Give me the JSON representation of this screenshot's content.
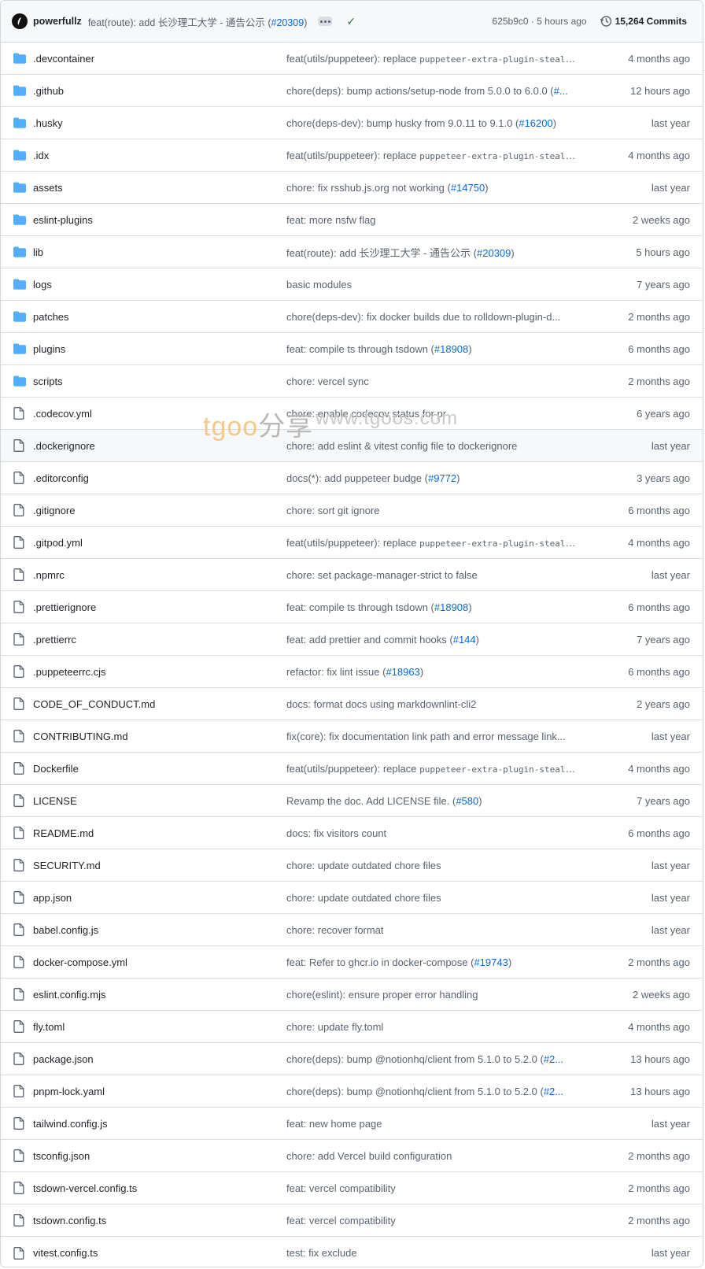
{
  "latest_commit": {
    "author": "powerfullz",
    "message": "feat(route): add 长沙理工大学 - 通告公示 (",
    "pr": "#20309",
    "message_end": ")",
    "sha_time": "625b9c0 · 5 hours ago",
    "commits_count": "15,264 Commits"
  },
  "watermark": {
    "brand": "tgoo",
    "cn": "分享",
    "url": "www.tgoos.com"
  },
  "rows": [
    {
      "type": "folder",
      "name": ".devcontainer",
      "pre": "feat(utils/puppeteer): replace ",
      "code": "puppeteer-extra-plugin-stealt...",
      "pr": "",
      "post": "",
      "age": "4 months ago"
    },
    {
      "type": "folder",
      "name": ".github",
      "pre": "chore(deps): bump actions/setup-node from 5.0.0 to 6.0.0 (",
      "code": "",
      "pr": "#...",
      "post": "",
      "age": "12 hours ago"
    },
    {
      "type": "folder",
      "name": ".husky",
      "pre": "chore(deps-dev): bump husky from 9.0.11 to 9.1.0 (",
      "code": "",
      "pr": "#16200",
      "post": ")",
      "age": "last year"
    },
    {
      "type": "folder",
      "name": ".idx",
      "pre": "feat(utils/puppeteer): replace ",
      "code": "puppeteer-extra-plugin-stealt...",
      "pr": "",
      "post": "",
      "age": "4 months ago"
    },
    {
      "type": "folder",
      "name": "assets",
      "pre": "chore: fix rsshub.js.org not working (",
      "code": "",
      "pr": "#14750",
      "post": ")",
      "age": "last year"
    },
    {
      "type": "folder",
      "name": "eslint-plugins",
      "pre": "feat: more nsfw flag",
      "code": "",
      "pr": "",
      "post": "",
      "age": "2 weeks ago"
    },
    {
      "type": "folder",
      "name": "lib",
      "pre": "feat(route): add 长沙理工大学 - 通告公示 (",
      "code": "",
      "pr": "#20309",
      "post": ")",
      "age": "5 hours ago"
    },
    {
      "type": "folder",
      "name": "logs",
      "pre": "basic modules",
      "code": "",
      "pr": "",
      "post": "",
      "age": "7 years ago"
    },
    {
      "type": "folder",
      "name": "patches",
      "pre": "chore(deps-dev): fix docker builds due to rolldown-plugin-d...",
      "code": "",
      "pr": "",
      "post": "",
      "age": "2 months ago"
    },
    {
      "type": "folder",
      "name": "plugins",
      "pre": "feat: compile ts through tsdown (",
      "code": "",
      "pr": "#18908",
      "post": ")",
      "age": "6 months ago"
    },
    {
      "type": "folder",
      "name": "scripts",
      "pre": "chore: vercel sync",
      "code": "",
      "pr": "",
      "post": "",
      "age": "2 months ago"
    },
    {
      "type": "file",
      "name": ".codecov.yml",
      "pre": "chore: enable codecov status for pr",
      "code": "",
      "pr": "",
      "post": "",
      "age": "6 years ago"
    },
    {
      "type": "file",
      "name": ".dockerignore",
      "pre": "chore: add eslint & vitest config file to dockerignore",
      "code": "",
      "pr": "",
      "post": "",
      "age": "last year",
      "highlight": true
    },
    {
      "type": "file",
      "name": ".editorconfig",
      "pre": "docs(*): add puppeteer budge (",
      "code": "",
      "pr": "#9772",
      "post": ")",
      "age": "3 years ago"
    },
    {
      "type": "file",
      "name": ".gitignore",
      "pre": "chore: sort git ignore",
      "code": "",
      "pr": "",
      "post": "",
      "age": "6 months ago"
    },
    {
      "type": "file",
      "name": ".gitpod.yml",
      "pre": "feat(utils/puppeteer): replace ",
      "code": "puppeteer-extra-plugin-stealt...",
      "pr": "",
      "post": "",
      "age": "4 months ago"
    },
    {
      "type": "file",
      "name": ".npmrc",
      "pre": "chore: set package-manager-strict to false",
      "code": "",
      "pr": "",
      "post": "",
      "age": "last year"
    },
    {
      "type": "file",
      "name": ".prettierignore",
      "pre": "feat: compile ts through tsdown (",
      "code": "",
      "pr": "#18908",
      "post": ")",
      "age": "6 months ago"
    },
    {
      "type": "file",
      "name": ".prettierrc",
      "pre": "feat: add prettier and commit hooks (",
      "code": "",
      "pr": "#144",
      "post": ")",
      "age": "7 years ago"
    },
    {
      "type": "file",
      "name": ".puppeteerrc.cjs",
      "pre": "refactor: fix lint issue (",
      "code": "",
      "pr": "#18963",
      "post": ")",
      "age": "6 months ago"
    },
    {
      "type": "file",
      "name": "CODE_OF_CONDUCT.md",
      "pre": "docs: format docs using markdownlint-cli2",
      "code": "",
      "pr": "",
      "post": "",
      "age": "2 years ago"
    },
    {
      "type": "file",
      "name": "CONTRIBUTING.md",
      "pre": "fix(core): fix documentation link path and error message link...",
      "code": "",
      "pr": "",
      "post": "",
      "age": "last year"
    },
    {
      "type": "file",
      "name": "Dockerfile",
      "pre": "feat(utils/puppeteer): replace ",
      "code": "puppeteer-extra-plugin-stealt...",
      "pr": "",
      "post": "",
      "age": "4 months ago"
    },
    {
      "type": "file",
      "name": "LICENSE",
      "pre": "Revamp the doc. Add LICENSE file. (",
      "code": "",
      "pr": "#580",
      "post": ")",
      "age": "7 years ago"
    },
    {
      "type": "file",
      "name": "README.md",
      "pre": "docs: fix visitors count",
      "code": "",
      "pr": "",
      "post": "",
      "age": "6 months ago"
    },
    {
      "type": "file",
      "name": "SECURITY.md",
      "pre": "chore: update outdated chore files",
      "code": "",
      "pr": "",
      "post": "",
      "age": "last year"
    },
    {
      "type": "file",
      "name": "app.json",
      "pre": "chore: update outdated chore files",
      "code": "",
      "pr": "",
      "post": "",
      "age": "last year"
    },
    {
      "type": "file",
      "name": "babel.config.js",
      "pre": "chore: recover format",
      "code": "",
      "pr": "",
      "post": "",
      "age": "last year"
    },
    {
      "type": "file",
      "name": "docker-compose.yml",
      "pre": "feat: Refer to ghcr.io in docker-compose (",
      "code": "",
      "pr": "#19743",
      "post": ")",
      "age": "2 months ago"
    },
    {
      "type": "file",
      "name": "eslint.config.mjs",
      "pre": "chore(eslint): ensure proper error handling",
      "code": "",
      "pr": "",
      "post": "",
      "age": "2 weeks ago"
    },
    {
      "type": "file",
      "name": "fly.toml",
      "pre": "chore: update fly.toml",
      "code": "",
      "pr": "",
      "post": "",
      "age": "4 months ago"
    },
    {
      "type": "file",
      "name": "package.json",
      "pre": "chore(deps): bump @notionhq/client from 5.1.0 to 5.2.0 (",
      "code": "",
      "pr": "#2...",
      "post": "",
      "age": "13 hours ago"
    },
    {
      "type": "file",
      "name": "pnpm-lock.yaml",
      "pre": "chore(deps): bump @notionhq/client from 5.1.0 to 5.2.0 (",
      "code": "",
      "pr": "#2...",
      "post": "",
      "age": "13 hours ago"
    },
    {
      "type": "file",
      "name": "tailwind.config.js",
      "pre": "feat: new home page",
      "code": "",
      "pr": "",
      "post": "",
      "age": "last year"
    },
    {
      "type": "file",
      "name": "tsconfig.json",
      "pre": "chore: add Vercel build configuration",
      "code": "",
      "pr": "",
      "post": "",
      "age": "2 months ago"
    },
    {
      "type": "file",
      "name": "tsdown-vercel.config.ts",
      "pre": "feat: vercel compatibility",
      "code": "",
      "pr": "",
      "post": "",
      "age": "2 months ago"
    },
    {
      "type": "file",
      "name": "tsdown.config.ts",
      "pre": "feat: vercel compatibility",
      "code": "",
      "pr": "",
      "post": "",
      "age": "2 months ago"
    },
    {
      "type": "file",
      "name": "vitest.config.ts",
      "pre": "test: fix exclude",
      "code": "",
      "pr": "",
      "post": "",
      "age": "last year"
    }
  ]
}
